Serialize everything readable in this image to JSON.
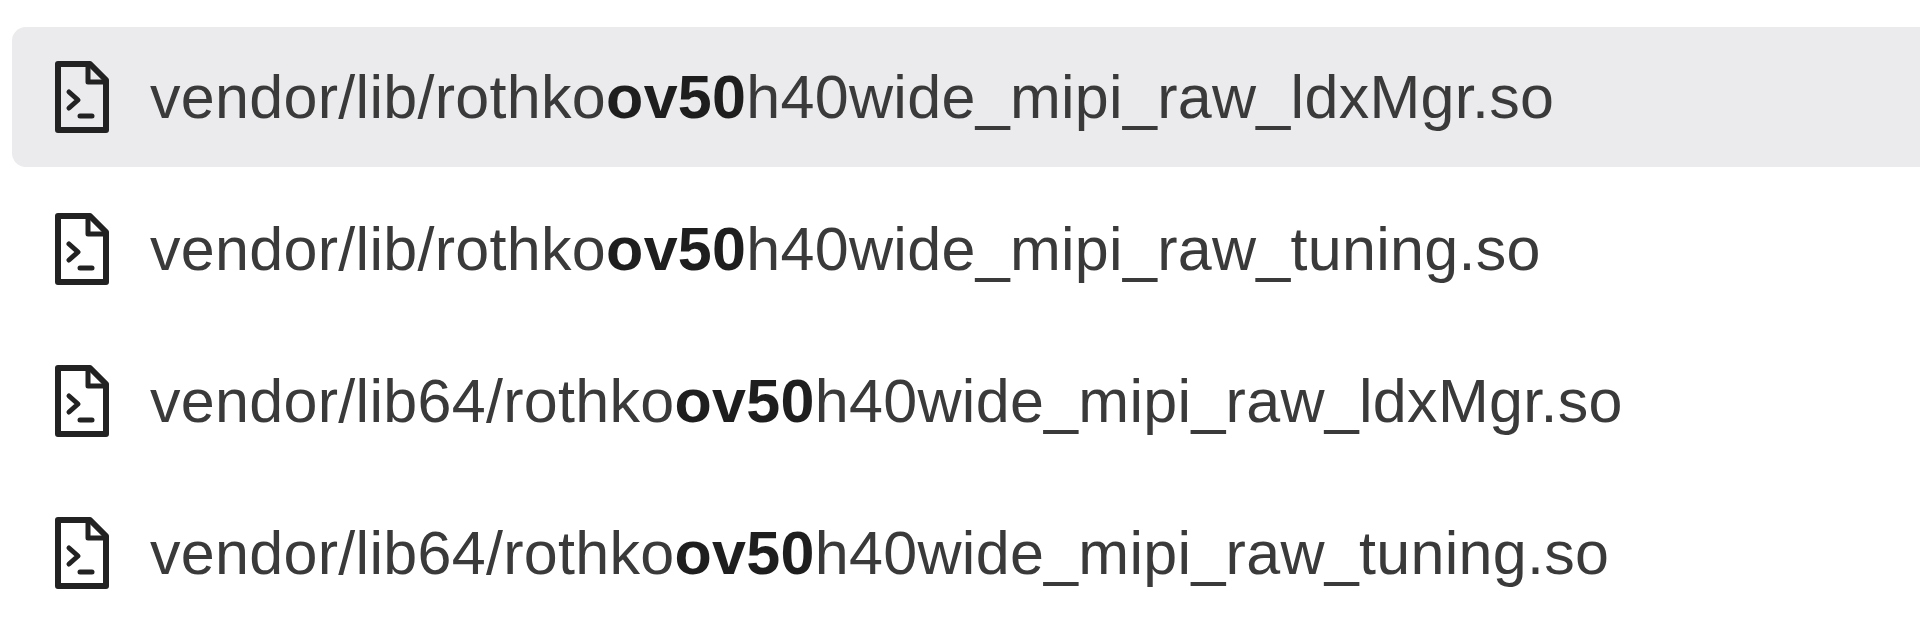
{
  "files": [
    {
      "path": "vendor/lib/rothko**ov50**h40wide_mipi_raw_ldxMgr.so",
      "selected": true
    },
    {
      "path": "vendor/lib/rothko**ov50**h40wide_mipi_raw_tuning.so",
      "selected": false
    },
    {
      "path": "vendor/lib64/rothko**ov50**h40wide_mipi_raw_ldxMgr.so",
      "selected": false
    },
    {
      "path": "vendor/lib64/rothko**ov50**h40wide_mipi_raw_tuning.so",
      "selected": false
    }
  ]
}
